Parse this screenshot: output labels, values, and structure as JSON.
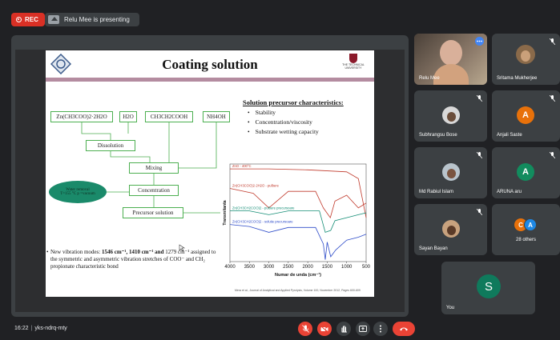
{
  "topbar": {
    "rec_label": "REC",
    "presenting_text": "Relu Mee is presenting"
  },
  "slide": {
    "title": "Coating solution",
    "logo_right_text": "THE TECHNICAL UNIVERSITY",
    "boxes": {
      "zinc_acetate": "Zn(CH3COO)2·2H2O",
      "water": "H2O",
      "acetic_acid": "CH3CH2COOH",
      "ammonia": "NH4OH",
      "dissolution": "Dissolution",
      "mixing": "Mixing",
      "concentration": "Concentration",
      "precursor": "Precursor solution"
    },
    "oval_line1": "Water removal",
    "oval_line2": "T=155 °C p =vacuum",
    "precursor_title": "Solution precursor characteristics:",
    "precursor_items": [
      "Stability",
      "Concentration/viscosity",
      "Substrate wetting capacity"
    ],
    "vibration_text_a": "New vibration modes: ",
    "vibration_bold": "1546 cm⁻¹, 1410 cm⁻¹ and",
    "vibration_text_b": "1279 cm⁻¹ assigned to the symmetric and asymmetric vibration stretches of COO⁻ and CH₂ propionate characteristic bond",
    "chart_caption": "Mera et al., Journal of Analytical and Applied Pyrolysis, Volume 100, November 2012, Pages 600-609"
  },
  "chart_data": {
    "type": "line",
    "title": "",
    "xlabel": "Numar de unda (cm⁻¹)",
    "ylabel": "Transmitanta",
    "x_ticks": [
      "4000",
      "3500",
      "3000",
      "2500",
      "2000",
      "1500",
      "1000",
      "500"
    ],
    "xlim": [
      4000,
      500
    ],
    "series": [
      {
        "name": "ZnO - 400°C",
        "color": "#c0392b",
        "points": [
          [
            4000,
            0.95
          ],
          [
            3000,
            0.95
          ],
          [
            2000,
            0.94
          ],
          [
            1000,
            0.92
          ],
          [
            700,
            0.85
          ],
          [
            500,
            0.45
          ]
        ]
      },
      {
        "name": "Zn(CH3COO)2·2H2O - pulbere",
        "color": "#c0392b",
        "points": [
          [
            4000,
            0.75
          ],
          [
            3400,
            0.7
          ],
          [
            3000,
            0.55
          ],
          [
            2500,
            0.72
          ],
          [
            1800,
            0.72
          ],
          [
            1600,
            0.55
          ],
          [
            1420,
            0.45
          ],
          [
            1300,
            0.62
          ],
          [
            1000,
            0.68
          ],
          [
            700,
            0.55
          ],
          [
            500,
            0.6
          ]
        ]
      },
      {
        "name": "Zn(CH3CH2COO)2 - pulbere precursoare",
        "color": "#138d75",
        "points": [
          [
            4000,
            0.52
          ],
          [
            3500,
            0.52
          ],
          [
            3000,
            0.48
          ],
          [
            2500,
            0.52
          ],
          [
            1700,
            0.52
          ],
          [
            1550,
            0.3
          ],
          [
            1410,
            0.32
          ],
          [
            1300,
            0.42
          ],
          [
            1000,
            0.45
          ],
          [
            700,
            0.48
          ],
          [
            500,
            0.5
          ]
        ]
      },
      {
        "name": "Zn(CH3CH2COO)2 - solutie precursoare",
        "color": "#2e4cc9",
        "points": [
          [
            4000,
            0.38
          ],
          [
            3500,
            0.36
          ],
          [
            3000,
            0.3
          ],
          [
            2500,
            0.35
          ],
          [
            1800,
            0.35
          ],
          [
            1600,
            0.18
          ],
          [
            1550,
            0.02
          ],
          [
            1500,
            0.2
          ],
          [
            1410,
            0.05
          ],
          [
            1280,
            0.12
          ],
          [
            1000,
            0.22
          ],
          [
            700,
            0.25
          ],
          [
            500,
            0.28
          ]
        ]
      }
    ]
  },
  "participants": [
    {
      "name": "Relu Mee",
      "speaking": true
    },
    {
      "name": "Sritama Mukherjee",
      "muted": true
    },
    {
      "name": "Subhrangsu Bose",
      "muted": true
    },
    {
      "name": "Anjali Saste",
      "initial": "A",
      "muted": true,
      "color": "#e8710a"
    },
    {
      "name": "Md Rabiul Islam",
      "muted": true
    },
    {
      "name": "ARUNA aru",
      "initial": "A",
      "muted": true,
      "color": "#128c5e"
    },
    {
      "name": "Sayan Bayan",
      "muted": true
    },
    {
      "name": "28 others",
      "initials": [
        "C",
        "A"
      ],
      "initial_colors": [
        "#e8710a",
        "#1e88e5"
      ]
    },
    {
      "name": "You",
      "initial": "S",
      "color": "#0f7a5c"
    }
  ],
  "bottombar": {
    "time": "16:22",
    "meeting_code": "yks-ndrq-mty"
  },
  "colors": {
    "background": "#202124",
    "tile": "#3c4043",
    "danger": "#ea4335"
  }
}
